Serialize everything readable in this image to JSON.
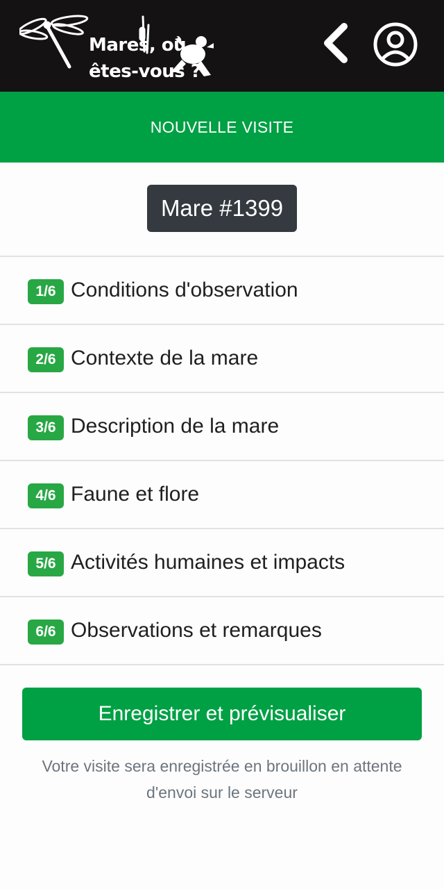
{
  "app": {
    "logo_line1": "Mares, où",
    "logo_line2": "êtes-vous ?"
  },
  "header": {
    "back_icon": "chevron-left-icon",
    "user_icon": "user-circle-icon",
    "section_title": "NOUVELLE VISITE"
  },
  "mare": {
    "label": "Mare #1399"
  },
  "steps": [
    {
      "badge": "1/6",
      "label": "Conditions d'observation"
    },
    {
      "badge": "2/6",
      "label": "Contexte de la mare"
    },
    {
      "badge": "3/6",
      "label": "Description de la mare"
    },
    {
      "badge": "4/6",
      "label": "Faune et flore"
    },
    {
      "badge": "5/6",
      "label": "Activités humaines et impacts"
    },
    {
      "badge": "6/6",
      "label": "Observations et remarques"
    }
  ],
  "actions": {
    "save_label": "Enregistrer et prévisualiser",
    "note": "Votre visite sera enregistrée en brouillon en attente d'envoi sur le serveur"
  },
  "colors": {
    "topbar": "#141213",
    "accent_green": "#00a044",
    "badge_green": "#28a745",
    "mare_badge": "#343a40"
  }
}
